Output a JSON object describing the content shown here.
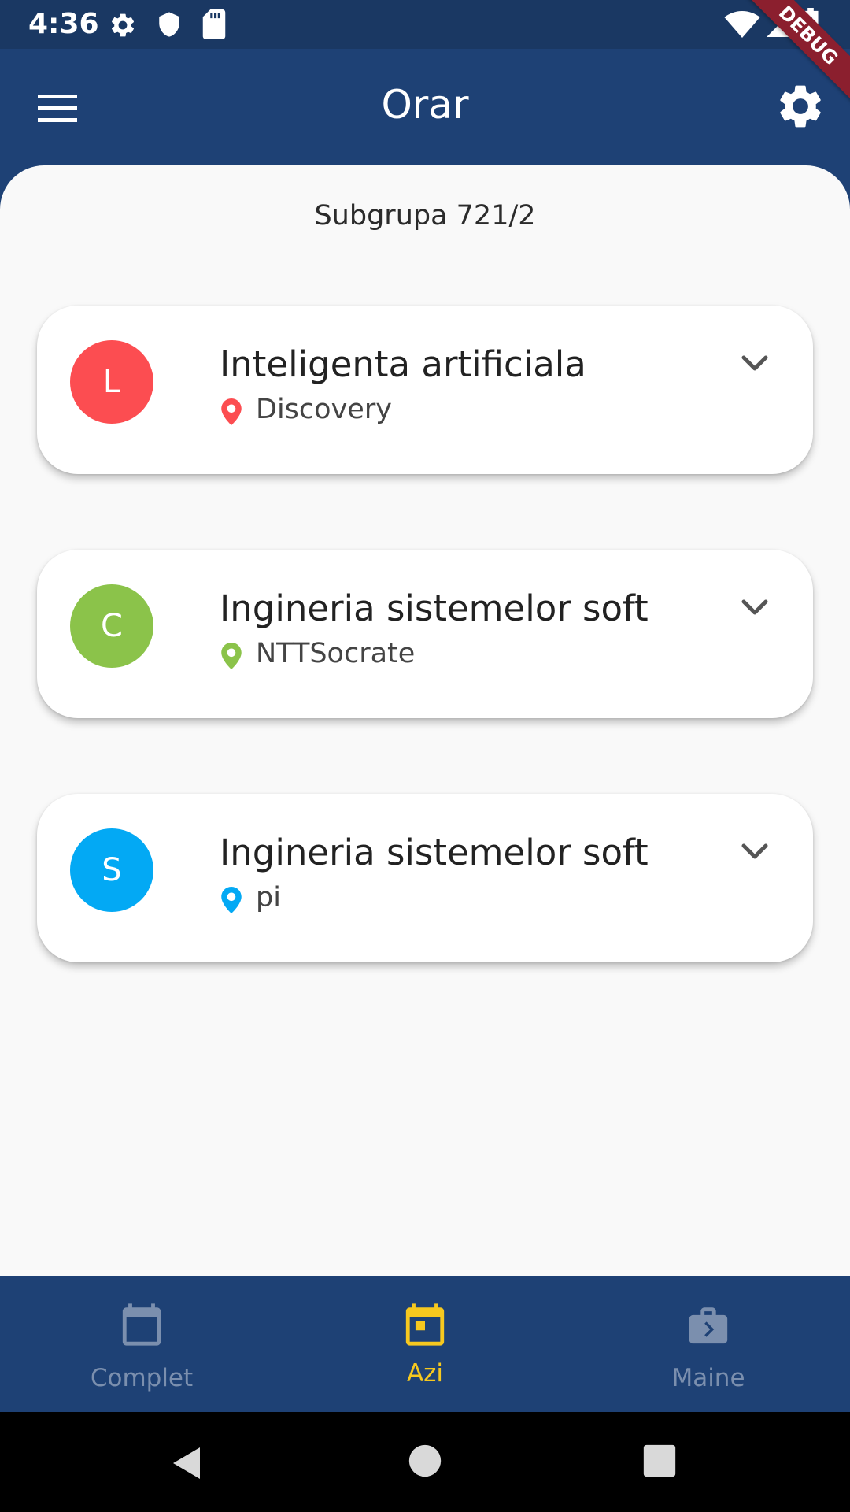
{
  "status_bar": {
    "time": "4:36",
    "icons": [
      "settings-icon",
      "shield-icon",
      "sd-card-icon",
      "wifi-icon",
      "signal-icon",
      "battery-charging-icon"
    ],
    "debug_label": "DEBUG"
  },
  "app_bar": {
    "title": "Orar",
    "menu_icon": "menu-icon",
    "settings_icon": "gear-icon"
  },
  "subgroup_label": "Subgrupa 721/2",
  "courses": [
    {
      "initial": "L",
      "title": "Inteligenta artificiala",
      "location": "Discovery",
      "color": "#fc4d51"
    },
    {
      "initial": "C",
      "title": "Ingineria sistemelor soft",
      "location": "NTTSocrate",
      "color": "#8bc34a"
    },
    {
      "initial": "S",
      "title": "Ingineria sistemelor soft",
      "location": "pi",
      "color": "#03a9f4"
    }
  ],
  "bottom_nav": {
    "items": [
      {
        "label": "Complet",
        "icon": "calendar-icon",
        "active": false
      },
      {
        "label": "Azi",
        "icon": "calendar-today-icon",
        "active": true
      },
      {
        "label": "Maine",
        "icon": "next-week-icon",
        "active": false
      }
    ],
    "active_color": "#f6c81f",
    "inactive_color": "#7b8fae"
  },
  "system_nav": [
    "back-icon",
    "home-icon",
    "recents-icon"
  ]
}
